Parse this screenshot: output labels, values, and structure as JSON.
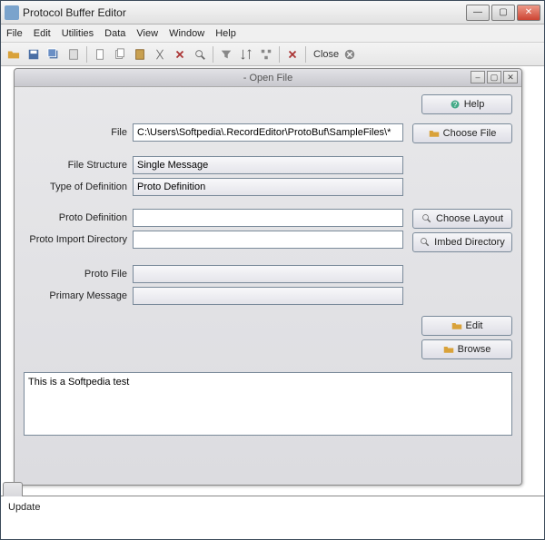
{
  "window": {
    "title": "Protocol Buffer Editor"
  },
  "menubar": {
    "items": [
      "File",
      "Edit",
      "Utilities",
      "Data",
      "View",
      "Window",
      "Help"
    ]
  },
  "toolbar": {
    "close_label": "Close"
  },
  "inner_window": {
    "title": "- Open File"
  },
  "buttons": {
    "help": "Help",
    "choose_file": "Choose File",
    "choose_layout": "Choose Layout",
    "imbed_directory": "Imbed Directory",
    "edit": "Edit",
    "browse": "Browse"
  },
  "form": {
    "file_label": "File",
    "file_value": "C:\\Users\\Softpedia\\.RecordEditor\\ProtoBuf\\SampleFiles\\*",
    "file_structure_label": "File Structure",
    "file_structure_value": "Single Message",
    "type_of_definition_label": "Type of Definition",
    "type_of_definition_value": "Proto Definition",
    "proto_definition_label": "Proto Definition",
    "proto_definition_value": "",
    "proto_import_dir_label": "Proto Import Directory",
    "proto_import_dir_value": "",
    "proto_file_label": "Proto File",
    "proto_file_value": "",
    "primary_message_label": "Primary Message",
    "primary_message_value": ""
  },
  "textarea": {
    "value": "This is a Softpedia test"
  },
  "status": {
    "tab_label": "",
    "content": "Update"
  }
}
